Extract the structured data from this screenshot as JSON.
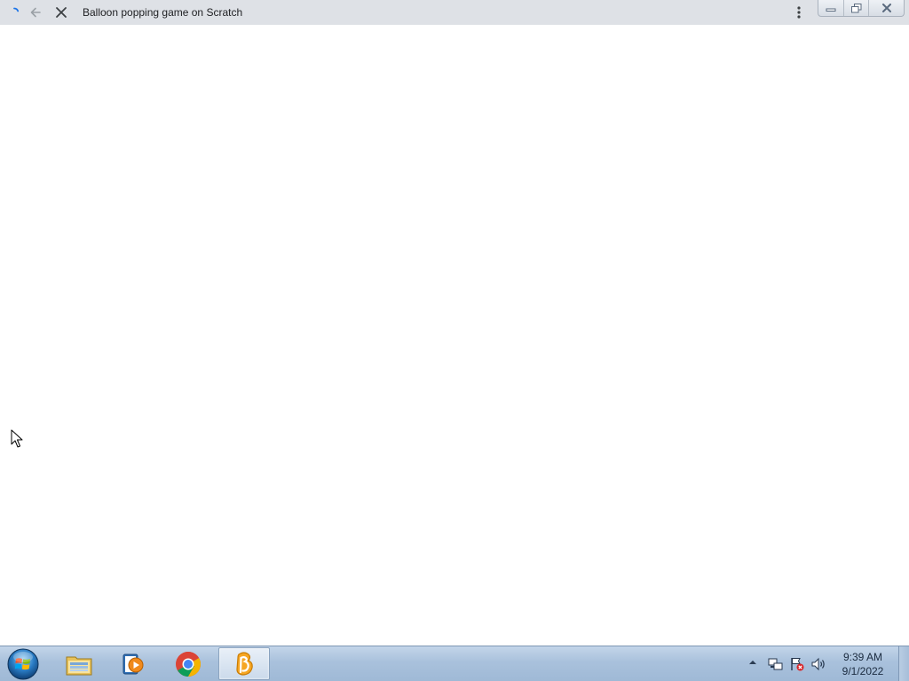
{
  "browser": {
    "page_title": "Balloon popping game on Scratch",
    "loading": true
  },
  "icons": {
    "spinner": "loading-spinner-icon",
    "back": "arrow-left-icon",
    "stop": "close-x-icon",
    "menu": "vertical-dots-icon",
    "minimize": "minimize-icon",
    "restore": "restore-icon",
    "close": "close-icon"
  },
  "taskbar": {
    "pinned": [
      {
        "name": "Windows Explorer",
        "icon": "folder-icon"
      },
      {
        "name": "Windows Media Player",
        "icon": "media-player-icon"
      },
      {
        "name": "Google Chrome",
        "icon": "chrome-icon"
      },
      {
        "name": "Scratch",
        "icon": "scratch-icon",
        "active": true
      }
    ],
    "clock": {
      "time": "9:39 AM",
      "date": "9/1/2022"
    }
  },
  "colors": {
    "titlebar": "#dee1e6",
    "taskbar": "#a9c1dc",
    "chrome_red": "#db4437",
    "chrome_green": "#0f9d58",
    "chrome_yellow": "#f4b400",
    "chrome_blue": "#4285f4",
    "scratch_orange": "#f6a623"
  }
}
